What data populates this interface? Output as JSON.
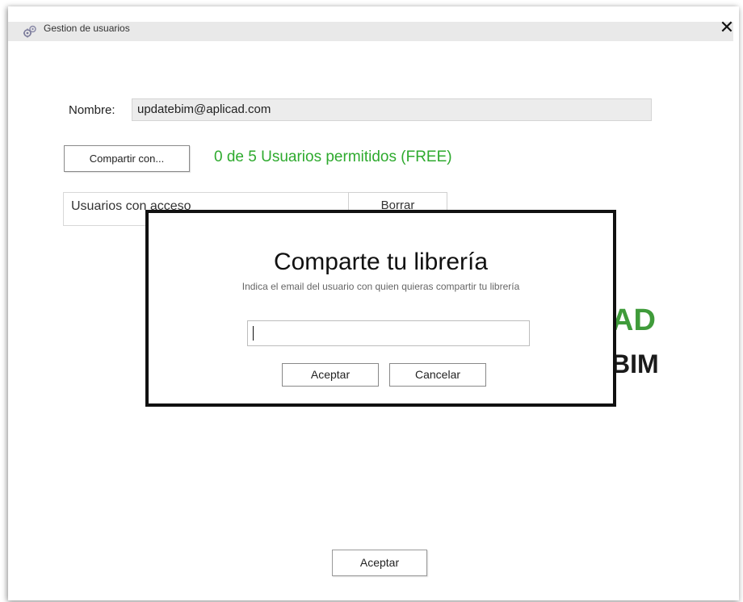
{
  "window": {
    "title": "Gestion de usuarios",
    "title_icon": "gear-users-icon",
    "close_icon": "close-icon",
    "close_glyph": "✕"
  },
  "form": {
    "nombre_label": "Nombre:",
    "nombre_value": "updatebim@aplicad.com",
    "share_button": "Compartir con...",
    "allowed_text": "0 de 5 Usuarios permitidos (FREE)",
    "allowed_color": "#2eaa2e",
    "users_label": "Usuarios con acceso",
    "delete_button": "Borrar"
  },
  "logo": {
    "line1": "AD",
    "line2": "BIM",
    "color1": "#3f9b3a"
  },
  "dialog": {
    "title": "Comparte tu librería",
    "subtitle": "Indica el email del usuario con quien quieras compartir tu librería",
    "email_value": "",
    "accept": "Aceptar",
    "cancel": "Cancelar"
  },
  "footer": {
    "accept": "Aceptar"
  }
}
